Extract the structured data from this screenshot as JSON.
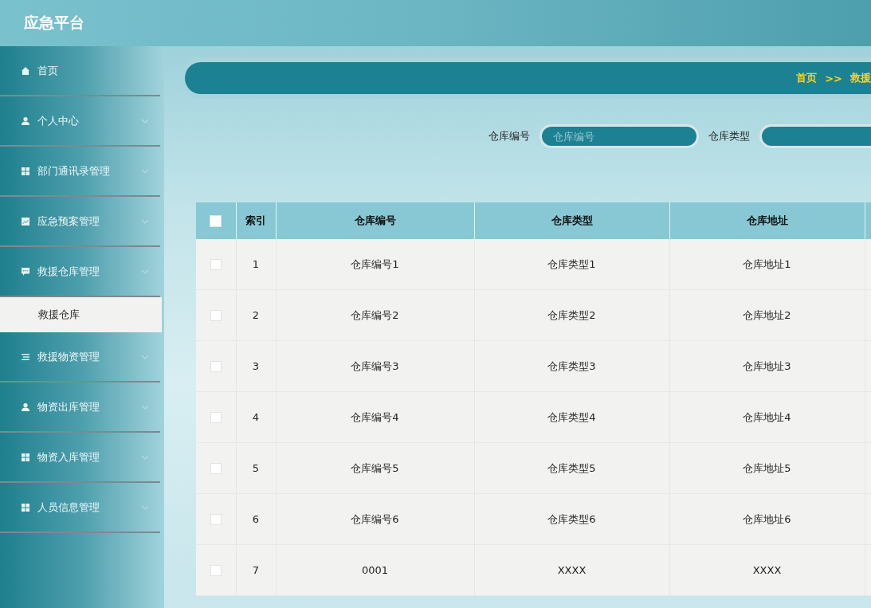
{
  "header": {
    "title": "应急平台"
  },
  "sidebar": {
    "items": [
      {
        "label": "首页",
        "kind": "link"
      },
      {
        "label": "个人中心",
        "kind": "submenu"
      },
      {
        "label": "部门通讯录管理",
        "kind": "submenu"
      },
      {
        "label": "应急预案管理",
        "kind": "submenu"
      },
      {
        "label": "救援仓库管理",
        "kind": "submenu",
        "children": [
          {
            "label": "救援仓库",
            "selected": true
          }
        ]
      },
      {
        "label": "救援物资管理",
        "kind": "submenu"
      },
      {
        "label": "物资出库管理",
        "kind": "submenu"
      },
      {
        "label": "物资入库管理",
        "kind": "submenu"
      },
      {
        "label": "人员信息管理",
        "kind": "submenu"
      }
    ]
  },
  "breadcrumb": [
    "首页",
    ">>",
    "救援"
  ],
  "search": [
    {
      "label": "仓库编号",
      "placeholder": "仓库编号"
    },
    {
      "label": "仓库类型"
    }
  ],
  "table": {
    "header_checked": false,
    "columns": [
      "索引",
      "仓库编号",
      "仓库类型",
      "仓库地址"
    ],
    "rows": [
      {
        "checked": false,
        "cells": [
          "1",
          "仓库编号1",
          "仓库类型1",
          "仓库地址1"
        ]
      },
      {
        "checked": false,
        "cells": [
          "2",
          "仓库编号2",
          "仓库类型2",
          "仓库地址2"
        ]
      },
      {
        "checked": false,
        "cells": [
          "3",
          "仓库编号3",
          "仓库类型3",
          "仓库地址3"
        ]
      },
      {
        "checked": false,
        "cells": [
          "4",
          "仓库编号4",
          "仓库类型4",
          "仓库地址4"
        ]
      },
      {
        "checked": false,
        "cells": [
          "5",
          "仓库编号5",
          "仓库类型5",
          "仓库地址5"
        ]
      },
      {
        "checked": false,
        "cells": [
          "6",
          "仓库编号6",
          "仓库类型6",
          "仓库地址6"
        ]
      },
      {
        "checked": false,
        "cells": [
          "7",
          "0001",
          "XXXX",
          "XXXX"
        ]
      }
    ]
  }
}
